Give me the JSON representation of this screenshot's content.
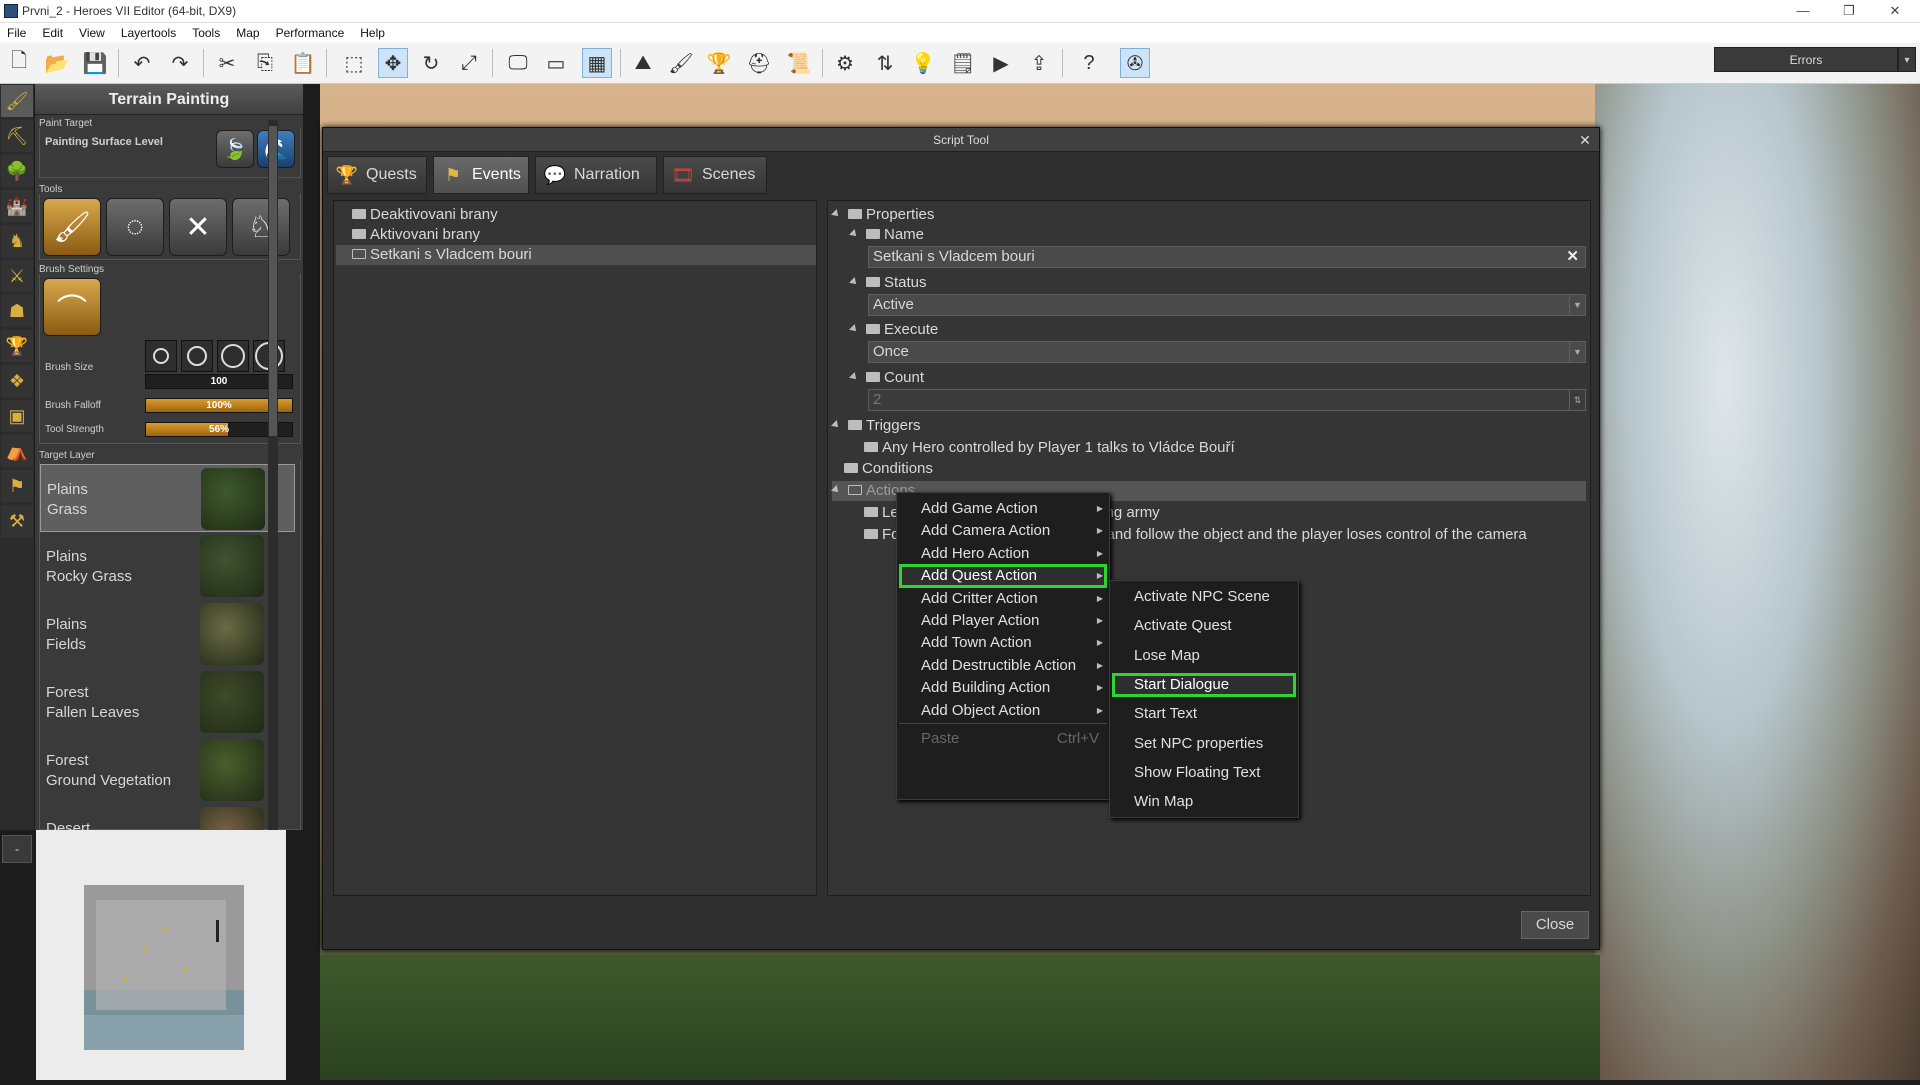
{
  "window": {
    "title": "Prvni_2 - Heroes VII Editor (64-bit, DX9)",
    "min": "—",
    "max": "❐",
    "close": "✕"
  },
  "menu": [
    "File",
    "Edit",
    "View",
    "Layertools",
    "Tools",
    "Map",
    "Performance",
    "Help"
  ],
  "errors": {
    "label": "Errors"
  },
  "terrain": {
    "header": "Terrain Painting",
    "paint_target_label": "Paint Target",
    "paint_surface": "Painting Surface Level",
    "tools_label": "Tools",
    "brush_settings_label": "Brush Settings",
    "brush_size_label": "Brush Size",
    "brush_size_value": "100",
    "brush_falloff_label": "Brush Falloff",
    "brush_falloff_value": "100%",
    "brush_falloff_fraction": 1.0,
    "tool_strength_label": "Tool Strength",
    "tool_strength_value": "56%",
    "tool_strength_fraction": 0.56,
    "target_layer_label": "Target Layer",
    "layers": [
      {
        "line1": "Plains",
        "line2": "Grass",
        "color": "#3d5a2a"
      },
      {
        "line1": "Plains",
        "line2": "Rocky Grass",
        "color": "#3f5430"
      },
      {
        "line1": "Plains",
        "line2": "Fields",
        "color": "#6c6a44"
      },
      {
        "line1": "Forest",
        "line2": "Fallen Leaves",
        "color": "#3f4a2a"
      },
      {
        "line1": "Forest",
        "line2": "Ground Vegetation",
        "color": "#4b5e2c"
      },
      {
        "line1": "Desert",
        "line2": "",
        "color": "#7a6244"
      }
    ]
  },
  "minimap": {
    "toggle": "-"
  },
  "script_tool": {
    "title": "Script Tool",
    "close_x": "✕",
    "tabs": [
      "Quests",
      "Events",
      "Narration",
      "Scenes"
    ],
    "events": [
      "Deaktivovani brany",
      "Aktivovani brany",
      "Setkani s Vladcem bouri"
    ],
    "properties": {
      "root": "Properties",
      "name_label": "Name",
      "name_value": "Setkani s Vladcem bouri",
      "name_clear": "✕",
      "status_label": "Status",
      "status_value": "Active",
      "execute_label": "Execute",
      "execute_value": "Once",
      "count_label": "Count",
      "count_value": "2",
      "triggers_label": "Triggers",
      "trigger_1": "Any Hero controlled by Player 1 talks to Vládce Bouří",
      "conditions_label": "Conditions",
      "actions_label": "Actions",
      "action_1_prefix": "Le",
      "action_1_suffix": "ting army",
      "action_2_prefix": "Focu",
      "action_2_suffix": "a and follow the object and the player loses control of the camera"
    },
    "close_button": "Close"
  },
  "context_menu": {
    "items": [
      "Add Game Action",
      "Add Camera Action",
      "Add Hero Action",
      "Add Quest Action",
      "Add Critter Action",
      "Add Player Action",
      "Add Town Action",
      "Add Destructible Action",
      "Add Building Action",
      "Add Object Action"
    ],
    "paste": "Paste",
    "paste_shortcut": "Ctrl+V"
  },
  "submenu": {
    "items": [
      "Activate NPC Scene",
      "Activate Quest",
      "Lose Map",
      "Start Dialogue",
      "Start Text",
      "Set NPC properties",
      "Show Floating Text",
      "Win Map"
    ]
  },
  "colors": {
    "highlight": "#2ed52e",
    "accent_gold": "#d79b2c"
  }
}
